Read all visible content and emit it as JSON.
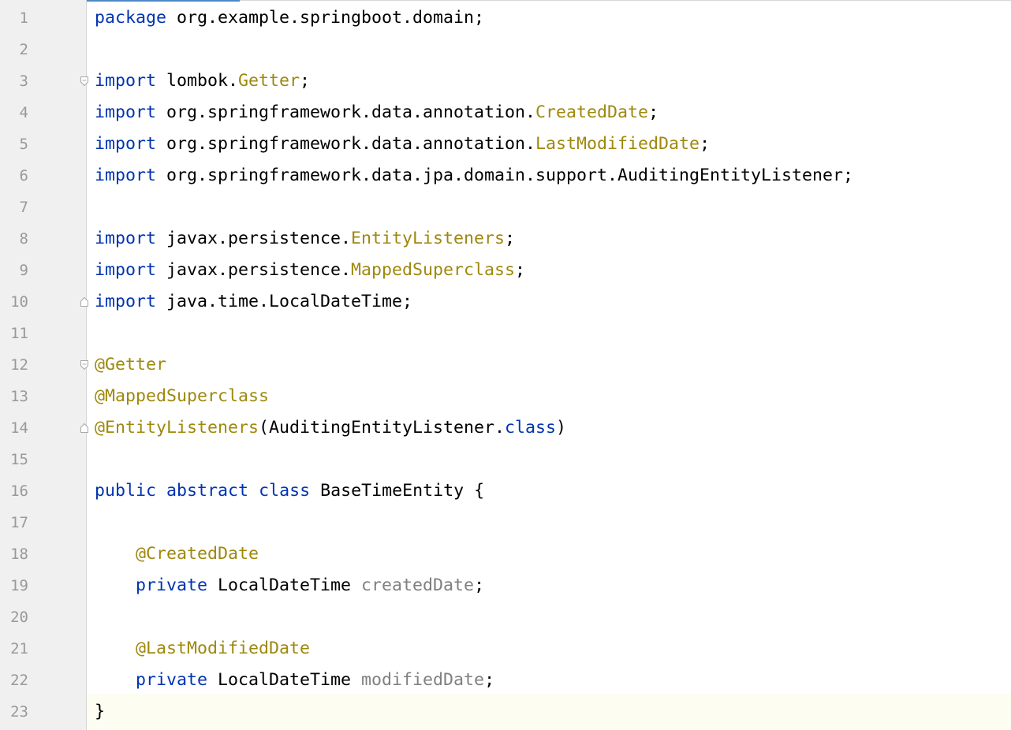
{
  "editor": {
    "accent_color": "#4a88c7",
    "colors": {
      "keyword": "#0033b3",
      "annotation": "#9e880d",
      "unused": "#808080",
      "text": "#000000",
      "line_number": "#999999"
    },
    "lines": [
      {
        "num": "1",
        "indent": "",
        "fold": "",
        "tokens": [
          {
            "t": "package",
            "k": "kw"
          },
          {
            "t": " org.example.springboot.domain;",
            "k": "plain"
          }
        ]
      },
      {
        "num": "2",
        "indent": "",
        "fold": "",
        "tokens": []
      },
      {
        "num": "3",
        "indent": "",
        "fold": "open",
        "tokens": [
          {
            "t": "import",
            "k": "kw"
          },
          {
            "t": " lombok.",
            "k": "plain"
          },
          {
            "t": "Getter",
            "k": "ann"
          },
          {
            "t": ";",
            "k": "plain"
          }
        ]
      },
      {
        "num": "4",
        "indent": "",
        "fold": "",
        "tokens": [
          {
            "t": "import",
            "k": "kw"
          },
          {
            "t": " org.springframework.data.annotation.",
            "k": "plain"
          },
          {
            "t": "CreatedDate",
            "k": "ann"
          },
          {
            "t": ";",
            "k": "plain"
          }
        ]
      },
      {
        "num": "5",
        "indent": "",
        "fold": "",
        "tokens": [
          {
            "t": "import",
            "k": "kw"
          },
          {
            "t": " org.springframework.data.annotation.",
            "k": "plain"
          },
          {
            "t": "LastModifiedDate",
            "k": "ann"
          },
          {
            "t": ";",
            "k": "plain"
          }
        ]
      },
      {
        "num": "6",
        "indent": "",
        "fold": "",
        "tokens": [
          {
            "t": "import",
            "k": "kw"
          },
          {
            "t": " org.springframework.data.jpa.domain.support.AuditingEntityListener;",
            "k": "plain"
          }
        ]
      },
      {
        "num": "7",
        "indent": "",
        "fold": "",
        "tokens": []
      },
      {
        "num": "8",
        "indent": "",
        "fold": "",
        "tokens": [
          {
            "t": "import",
            "k": "kw"
          },
          {
            "t": " javax.persistence.",
            "k": "plain"
          },
          {
            "t": "EntityListeners",
            "k": "ann"
          },
          {
            "t": ";",
            "k": "plain"
          }
        ]
      },
      {
        "num": "9",
        "indent": "",
        "fold": "",
        "tokens": [
          {
            "t": "import",
            "k": "kw"
          },
          {
            "t": " javax.persistence.",
            "k": "plain"
          },
          {
            "t": "MappedSuperclass",
            "k": "ann"
          },
          {
            "t": ";",
            "k": "plain"
          }
        ]
      },
      {
        "num": "10",
        "indent": "",
        "fold": "close",
        "tokens": [
          {
            "t": "import",
            "k": "kw"
          },
          {
            "t": " java.time.LocalDateTime;",
            "k": "plain"
          }
        ]
      },
      {
        "num": "11",
        "indent": "",
        "fold": "",
        "tokens": []
      },
      {
        "num": "12",
        "indent": "",
        "fold": "open",
        "tokens": [
          {
            "t": "@Getter",
            "k": "ann"
          }
        ]
      },
      {
        "num": "13",
        "indent": "",
        "fold": "",
        "tokens": [
          {
            "t": "@MappedSuperclass",
            "k": "ann"
          }
        ]
      },
      {
        "num": "14",
        "indent": "",
        "fold": "close",
        "tokens": [
          {
            "t": "@EntityListeners",
            "k": "ann"
          },
          {
            "t": "(AuditingEntityListener.",
            "k": "plain"
          },
          {
            "t": "class",
            "k": "kw"
          },
          {
            "t": ")",
            "k": "plain"
          }
        ]
      },
      {
        "num": "15",
        "indent": "",
        "fold": "",
        "tokens": []
      },
      {
        "num": "16",
        "indent": "",
        "fold": "",
        "tokens": [
          {
            "t": "public",
            "k": "kw"
          },
          {
            "t": " ",
            "k": "plain"
          },
          {
            "t": "abstract",
            "k": "kw"
          },
          {
            "t": " ",
            "k": "plain"
          },
          {
            "t": "class",
            "k": "kw"
          },
          {
            "t": " BaseTimeEntity {",
            "k": "plain"
          }
        ]
      },
      {
        "num": "17",
        "indent": "",
        "fold": "",
        "tokens": []
      },
      {
        "num": "18",
        "indent": "    ",
        "fold": "",
        "tokens": [
          {
            "t": "@CreatedDate",
            "k": "ann"
          }
        ]
      },
      {
        "num": "19",
        "indent": "    ",
        "fold": "",
        "tokens": [
          {
            "t": "private",
            "k": "kw"
          },
          {
            "t": " LocalDateTime ",
            "k": "plain"
          },
          {
            "t": "createdDate",
            "k": "gray"
          },
          {
            "t": ";",
            "k": "plain"
          }
        ]
      },
      {
        "num": "20",
        "indent": "",
        "fold": "",
        "tokens": []
      },
      {
        "num": "21",
        "indent": "    ",
        "fold": "",
        "tokens": [
          {
            "t": "@LastModifiedDate",
            "k": "ann"
          }
        ]
      },
      {
        "num": "22",
        "indent": "    ",
        "fold": "",
        "tokens": [
          {
            "t": "private",
            "k": "kw"
          },
          {
            "t": " LocalDateTime ",
            "k": "plain"
          },
          {
            "t": "modifiedDate",
            "k": "gray"
          },
          {
            "t": ";",
            "k": "plain"
          }
        ]
      },
      {
        "num": "23",
        "indent": "",
        "fold": "",
        "tokens": [
          {
            "t": "}",
            "k": "plain"
          }
        ]
      }
    ]
  }
}
